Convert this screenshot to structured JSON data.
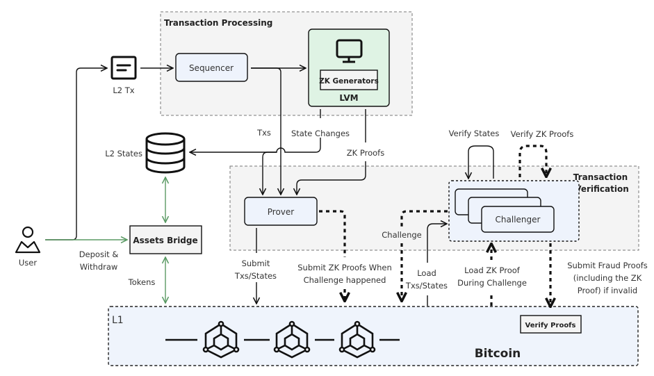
{
  "diagram": {
    "groups": {
      "transaction_processing": "Transaction Processing",
      "transaction_verification_line1": "Transaction",
      "transaction_verification_line2": "Verification",
      "l1": "L1"
    },
    "nodes": {
      "l2_tx": "L2 Tx",
      "sequencer": "Sequencer",
      "zk_generators": "ZK Generators",
      "lvm": "LVM",
      "l2_states": "L2 States",
      "user": "User",
      "assets_bridge": "Assets Bridge",
      "prover": "Prover",
      "challenger": "Challenger",
      "verify_proofs": "Verify Proofs",
      "bitcoin": "Bitcoin"
    },
    "edges": {
      "txs": "Txs",
      "state_changes": "State Changes",
      "zk_proofs": "ZK Proofs",
      "verify_states": "Verify States",
      "verify_zk_proofs": "Verify ZK Proofs",
      "deposit_withdraw_1": "Deposit &",
      "deposit_withdraw_2": "Withdraw",
      "tokens": "Tokens",
      "submit_txs_1": "Submit",
      "submit_txs_2": "Txs/States",
      "submit_zk_1": "Submit ZK Proofs When",
      "submit_zk_2": "Challenge happened",
      "challenge": "Challenge",
      "load_txs_1": "Load",
      "load_txs_2": "Txs/States",
      "load_zk_1": "Load ZK Proof",
      "load_zk_2": "During Challenge",
      "fraud_1": "Submit Fraud Proofs",
      "fraud_2": "(including the ZK",
      "fraud_3": "Proof) if invalid"
    },
    "colors": {
      "group_bg": "#f4f4f4",
      "node_blue": "#eef3fc",
      "node_green": "#dff3e4",
      "bridge_arrow": "#5a9a64",
      "l1_bg": "#eff4fc"
    }
  }
}
